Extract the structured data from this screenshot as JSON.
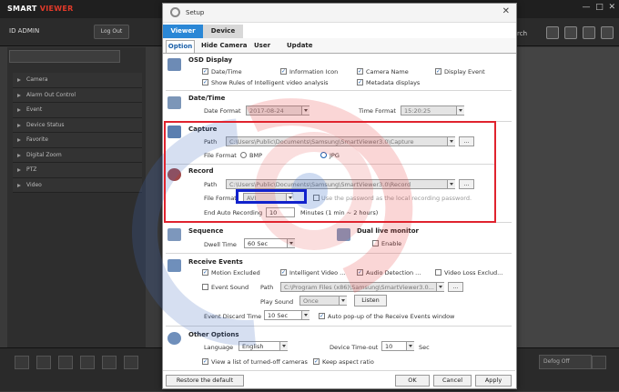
{
  "app": {
    "brand_main": "SMART",
    "brand_accent": "VIEWER",
    "id_label": "ID  ADMIN",
    "logout_label": "Log Out",
    "search_partial": "rch",
    "left_menu": [
      "Camera",
      "Alarm Out Control",
      "Event",
      "Device Status",
      "Favorite",
      "Digital Zoom",
      "PTZ",
      "Video"
    ],
    "defog_label": "Defog Off"
  },
  "dialog": {
    "title": "Setup",
    "close_glyph": "✕",
    "main_tabs": [
      "Viewer",
      "Device"
    ],
    "sub_tabs": [
      "Option",
      "Hide Camera",
      "User",
      "Update"
    ],
    "osd": {
      "title": "OSD Display",
      "items": [
        "Date/Time",
        "Information Icon",
        "Camera Name",
        "Display Event",
        "Show Rules of Intelligent video analysis",
        "Metadata displays"
      ]
    },
    "datetime": {
      "title": "Date/Time",
      "date_format_label": "Date Format",
      "date_format_value": "2017-08-24",
      "time_format_label": "Time Format",
      "time_format_value": "15:20:25"
    },
    "capture": {
      "title": "Capture",
      "path_label": "Path",
      "path_value": "C:\\Users\\Public\\Documents\\Samsung\\SmartViewer3.0\\Capture",
      "file_format_label": "File Format",
      "bmp_label": "BMP",
      "jpg_label": "JPG",
      "browse_label": "..."
    },
    "record": {
      "title": "Record",
      "path_label": "Path",
      "path_value": "C:\\Users\\Public\\Documents\\Samsung\\SmartViewer3.0\\Record",
      "file_format_label": "File Format",
      "file_format_value": "AVI",
      "use_password_label": "Use the password as the local recording password.",
      "end_auto_label": "End Auto Recording",
      "end_auto_value": "10",
      "minutes_label": "Minutes (1 min ~ 2 hours)"
    },
    "sequence": {
      "title": "Sequence",
      "dwell_label": "Dwell Time",
      "dwell_value": "60 Sec"
    },
    "dual_live": {
      "title": "Dual live monitor",
      "enable_label": "Enable"
    },
    "receive_events": {
      "title": "Receive Events",
      "items": [
        "Motion Excluded",
        "Intelligent Video ...",
        "Audio Detection ...",
        "Video Loss Exclud..."
      ],
      "event_sound_label": "Event Sound",
      "path_label": "Path",
      "path_value": "C:\\Program Files (x86)\\Samsung\\SmartViewer3.0...",
      "play_sound_label": "Play Sound",
      "play_sound_value": "Once",
      "listen_label": "Listen",
      "discard_label": "Event Discard Time",
      "discard_value": "10 Sec",
      "auto_popup_label": "Auto pop-up of the Receive Events window"
    },
    "other": {
      "title": "Other Options",
      "language_label": "Language",
      "language_value": "English",
      "timeout_label": "Device Time-out",
      "timeout_value": "10",
      "sec_label": "Sec",
      "turned_off_label": "View a list of turned-off cameras",
      "keep_aspect_label": "Keep aspect ratio"
    },
    "footer": {
      "restore_label": "Restore the default",
      "ok_label": "OK",
      "cancel_label": "Cancel",
      "apply_label": "Apply"
    }
  }
}
